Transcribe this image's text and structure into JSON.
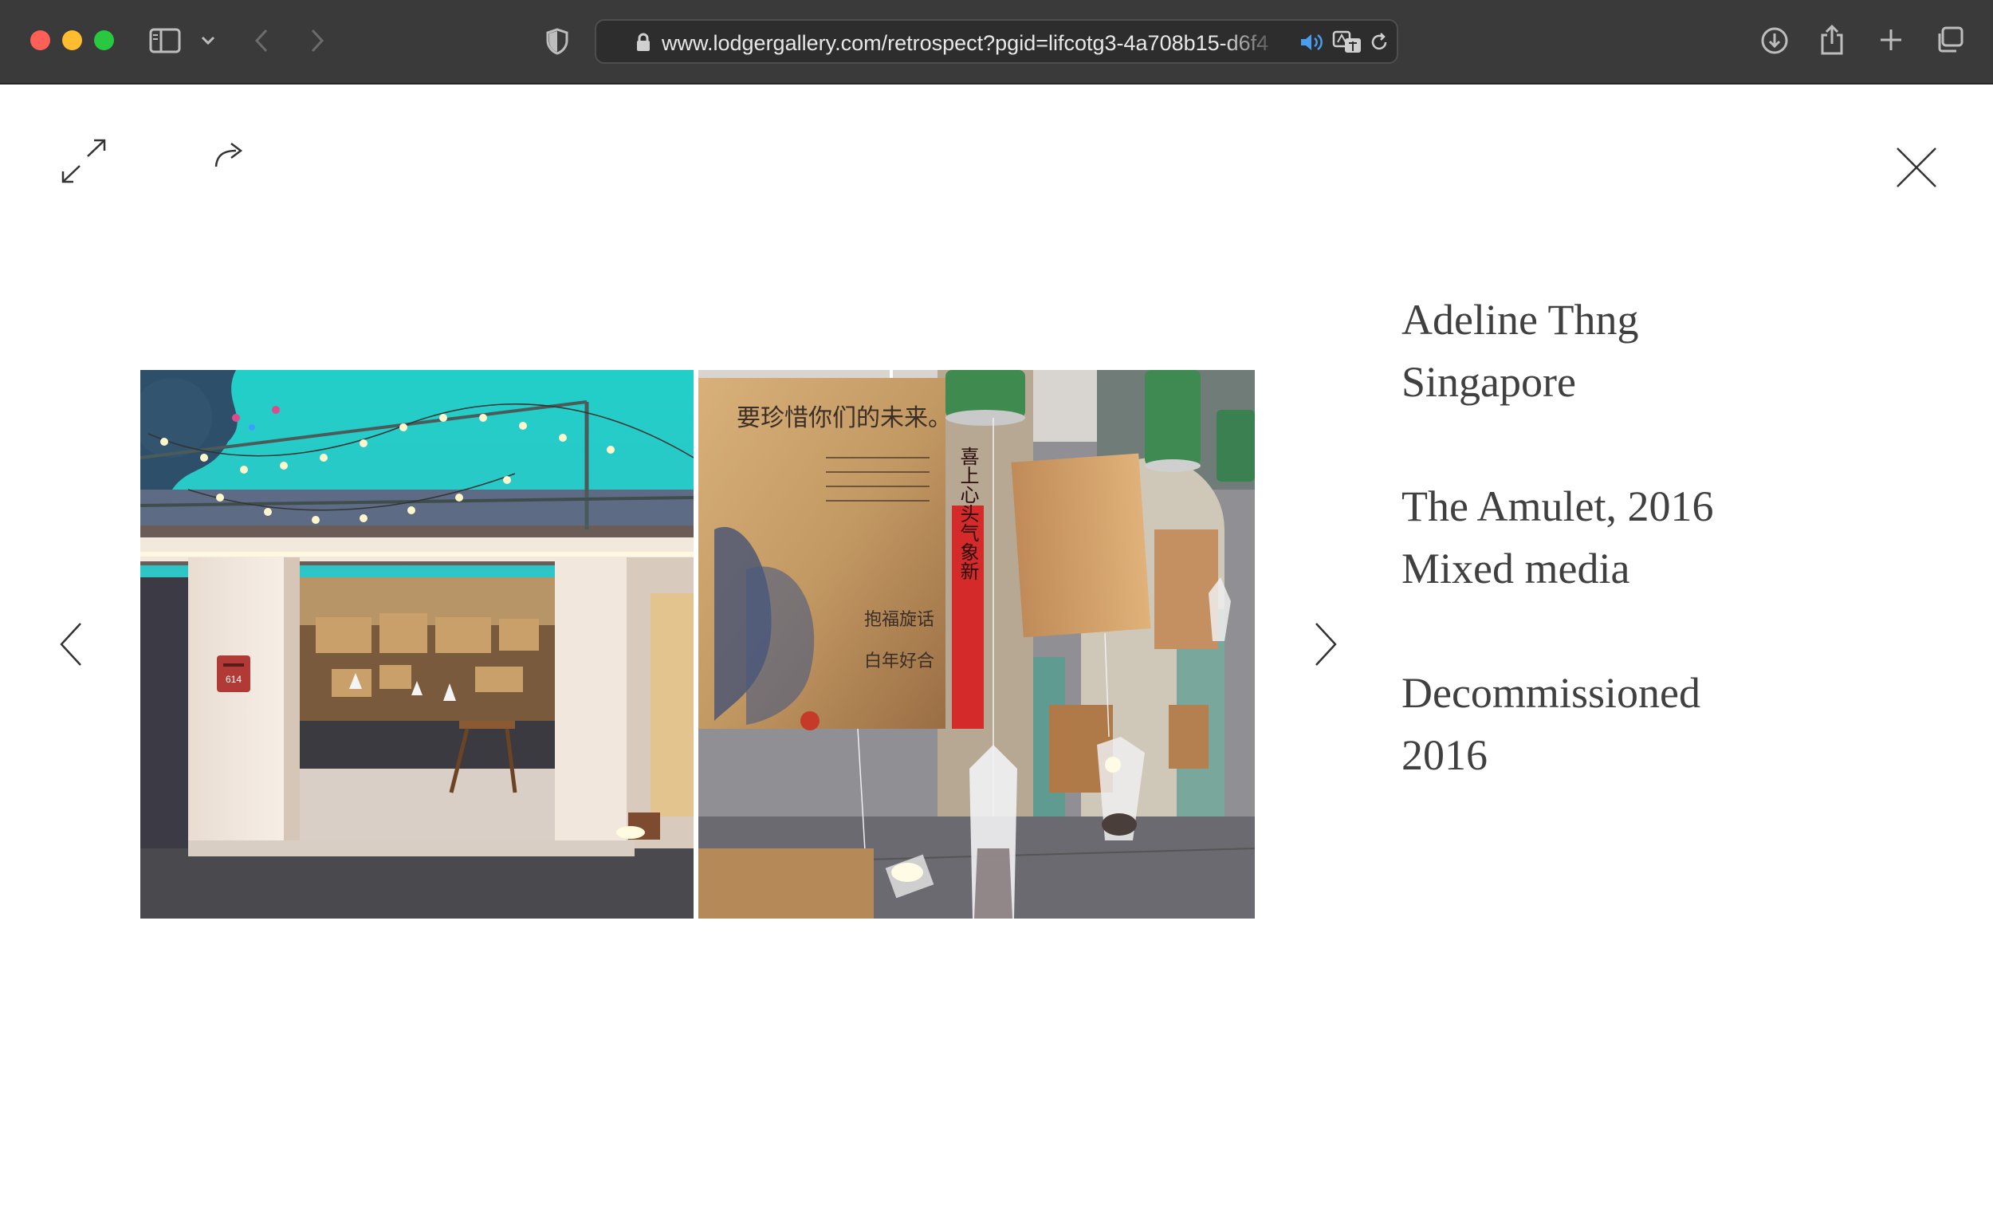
{
  "browser": {
    "url": "www.lodgergallery.com/retrospect?pgid=lifcotg3-4a708b15-d6f4",
    "icons": [
      "sidebar-icon",
      "chevron-down-icon",
      "back-icon",
      "forward-icon",
      "shield-icon",
      "lock-icon",
      "speaker-icon",
      "translate-icon",
      "reload-icon",
      "download-icon",
      "share-icon",
      "new-tab-icon",
      "tabs-overview-icon"
    ]
  },
  "viewer": {
    "icons": [
      "expand-icon",
      "share-arrow-icon",
      "close-icon",
      "prev-arrow-icon",
      "next-arrow-icon"
    ]
  },
  "artwork": {
    "artist": "Adeline Thng",
    "country": "Singapore",
    "title_year": "The Amulet, 2016",
    "medium": "Mixed media",
    "status": "Decommissioned",
    "status_year": "2016",
    "photo_text": {
      "mailbox_number": "614",
      "banner_line": "要珍惜你们的未来。",
      "red_strip": "喜上心头气象新",
      "sign_1": "抱福旋话",
      "sign_2": "白年好合"
    }
  },
  "colors": {
    "chrome_bg": "#3a3a3a",
    "url_bar_bg": "#2d2d2d",
    "text": "#404040",
    "sky": "#1fc9c4",
    "speaker_accent": "#4a9ef0"
  }
}
